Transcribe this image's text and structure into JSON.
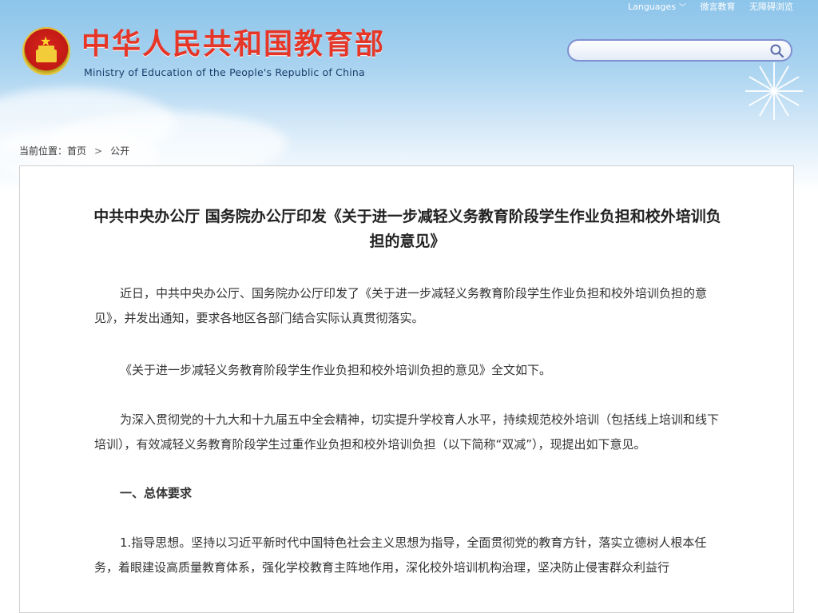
{
  "top_links": [
    "Languages",
    "微言教育",
    "无障碍浏览"
  ],
  "site": {
    "title": "中华人民共和国教育部",
    "subtitle": "Ministry of Education of the People's Republic of China"
  },
  "search": {
    "placeholder": ""
  },
  "breadcrumb": {
    "label": "当前位置：",
    "items": [
      "首页",
      "公开"
    ],
    "separator": ">"
  },
  "article": {
    "title": "中共中央办公厅 国务院办公厅印发《关于进一步减轻义务教育阶段学生作业负担和校外培训负担的意见》",
    "paragraphs": [
      "近日，中共中央办公厅、国务院办公厅印发了《关于进一步减轻义务教育阶段学生作业负担和校外培训负担的意见》，并发出通知，要求各地区各部门结合实际认真贯彻落实。",
      "《关于进一步减轻义务教育阶段学生作业负担和校外培训负担的意见》全文如下。",
      "为深入贯彻党的十九大和十九届五中全会精神，切实提升学校育人水平，持续规范校外培训（包括线上培训和线下培训），有效减轻义务教育阶段学生过重作业负担和校外培训负担（以下简称“双减”），现提出如下意见。",
      "一、总体要求",
      "1.指导思想。坚持以习近平新时代中国特色社会主义思想为指导，全面贯彻党的教育方针，落实立德树人根本任务，着眼建设高质量教育体系，强化学校教育主阵地作用，深化校外培训机构治理，坚决防止侵害群众利益行"
    ]
  },
  "colors": {
    "title_red": "#e53628",
    "subtitle_blue": "#1b3e6b",
    "search_border": "#7f8fd1"
  }
}
